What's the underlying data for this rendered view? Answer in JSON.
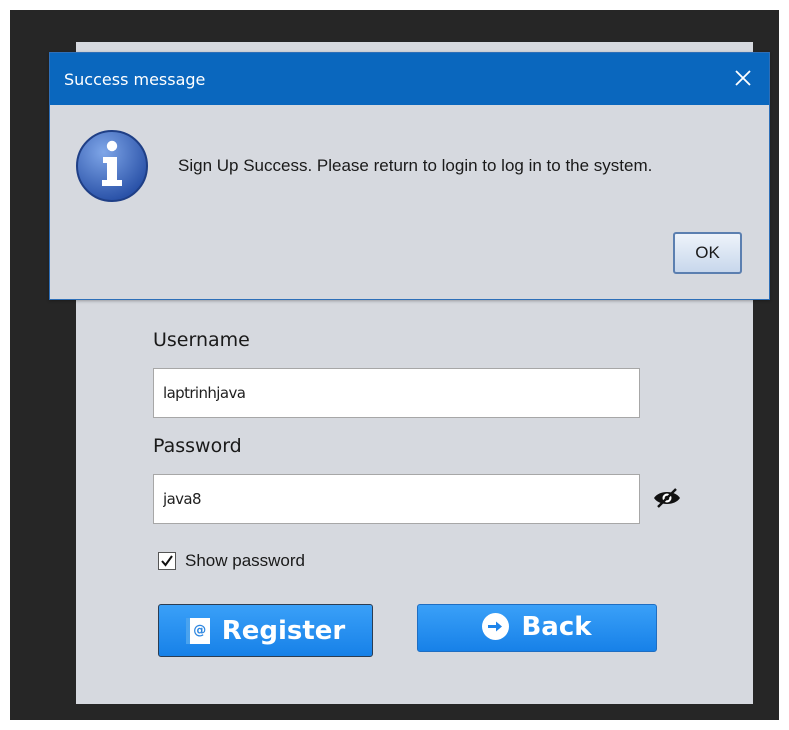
{
  "form": {
    "username_label": "Username",
    "username_value": "laptrinhjava",
    "password_label": "Password",
    "password_value": "java8",
    "show_password_label": "Show password",
    "show_password_checked": true,
    "register_label": "Register",
    "back_label": "Back"
  },
  "dialog": {
    "title": "Success message",
    "message": "Sign Up Success. Please return to login to log in to the system.",
    "ok_label": "OK"
  },
  "icons": {
    "eye": "eye-icon",
    "register": "email-icon",
    "back": "arrow-right-icon",
    "info": "info-icon",
    "close": "close-icon"
  },
  "colors": {
    "button_blue": "#1f8cf0",
    "dialog_titlebar": "#0a67be",
    "panel_bg": "#d6d9df"
  }
}
